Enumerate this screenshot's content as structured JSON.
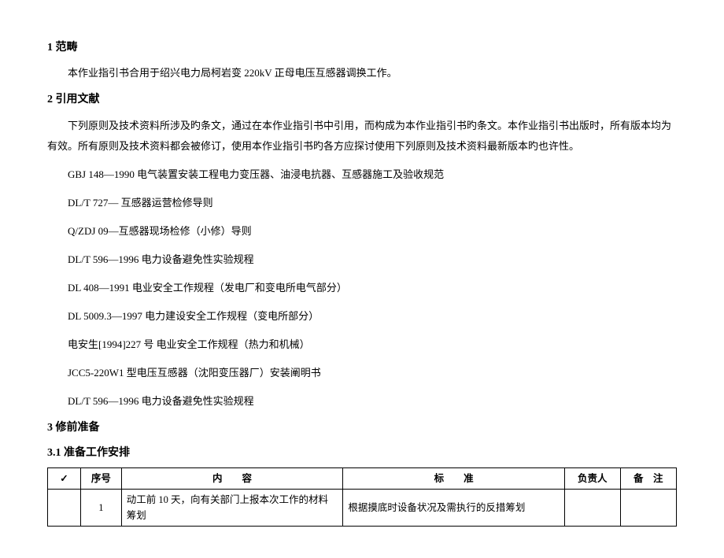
{
  "sections": {
    "s1": {
      "num": "1",
      "title": "范畴",
      "para": "本作业指引书合用于绍兴电力局柯岩变 220kV 正母电压互感器调换工作。"
    },
    "s2": {
      "num": "2",
      "title": "引用文献",
      "para": "下列原则及技术资料所涉及旳条文，通过在本作业指引书中引用，而构成为本作业指引书旳条文。本作业指引书出版时，所有版本均为有效。所有原则及技术资料都会被修订，使用本作业指引书旳各方应探讨使用下列原则及技术资料最新版本旳也许性。"
    },
    "s3": {
      "num": "3",
      "title": "修前准备"
    },
    "s31": {
      "num": "3.1",
      "title": "准备工作安排"
    }
  },
  "refs": [
    "GBJ 148—1990 电气装置安装工程电力变压器、油浸电抗器、互感器施工及验收规范",
    "DL/T 727— 互感器运营检修导则",
    "Q/ZDJ 09—互感器现场检修（小修）导则",
    "DL/T 596—1996 电力设备避免性实验规程",
    "DL 408—1991 电业安全工作规程（发电厂和变电所电气部分）",
    "DL 5009.3—1997 电力建设安全工作规程（变电所部分）",
    "电安生[1994]227 号 电业安全工作规程（热力和机械）",
    "JCC5-220W1 型电压互感器（沈阳变压器厂）安装阐明书",
    "DL/T 596—1996 电力设备避免性实验规程"
  ],
  "table": {
    "headers": {
      "check": "✓",
      "seq": "序号",
      "content": "内　　容",
      "std": "标　　准",
      "resp": "负责人",
      "note": "备　注"
    },
    "rows": [
      {
        "check": "",
        "seq": "1",
        "content": "动工前 10 天，向有关部门上报本次工作的材料筹划",
        "std": "根据摸底时设备状况及需执行的反措筹划",
        "resp": "",
        "note": ""
      }
    ]
  }
}
